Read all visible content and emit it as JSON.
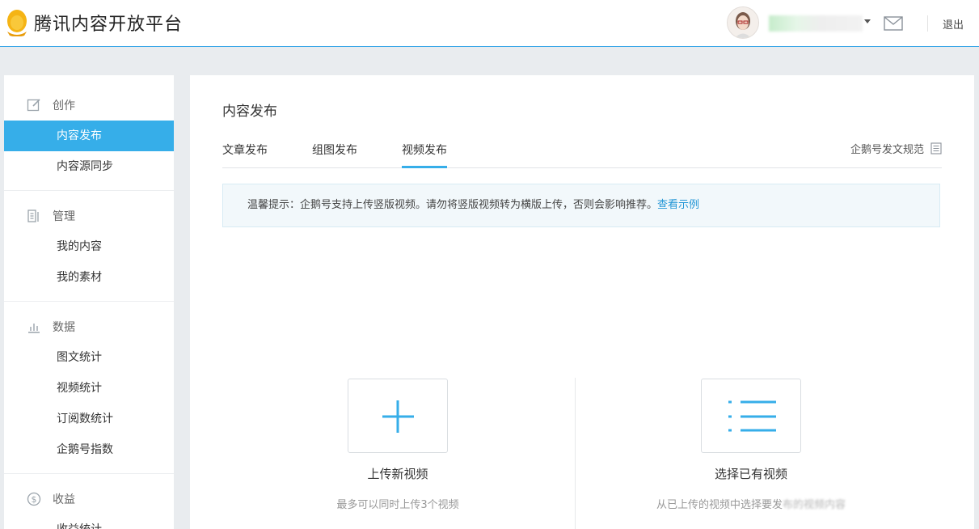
{
  "header": {
    "logo_text": "腾讯内容开放平台",
    "logout_label": "退出",
    "accent": "#36aee9"
  },
  "sidebar": {
    "groups": [
      {
        "title": "创作",
        "icon": "edit-icon",
        "items": [
          "内容发布",
          "内容源同步"
        ]
      },
      {
        "title": "管理",
        "icon": "manage-icon",
        "items": [
          "我的内容",
          "我的素材"
        ]
      },
      {
        "title": "数据",
        "icon": "bar-chart-icon",
        "items": [
          "图文统计",
          "视频统计",
          "订阅数统计",
          "企鹅号指数"
        ]
      },
      {
        "title": "收益",
        "icon": "dollar-icon",
        "items": [
          "收益统计"
        ]
      }
    ],
    "active_item": "内容发布"
  },
  "main": {
    "title": "内容发布",
    "tabs": [
      {
        "label": "文章发布",
        "active": false
      },
      {
        "label": "组图发布",
        "active": false
      },
      {
        "label": "视频发布",
        "active": true
      }
    ],
    "guide_link": "企鹅号发文规范",
    "notice": {
      "text": "温馨提示：企鹅号支持上传竖版视频。请勿将竖版视频转为横版上传，否则会影响推荐。",
      "link": "查看示例"
    },
    "upload_card": {
      "title": "上传新视频",
      "desc": "最多可以同时上传3个视频"
    },
    "select_card": {
      "title": "选择已有视频",
      "desc_visible": "从已上传的视频中选择要发",
      "desc_blurred": "布的视频内容"
    }
  }
}
